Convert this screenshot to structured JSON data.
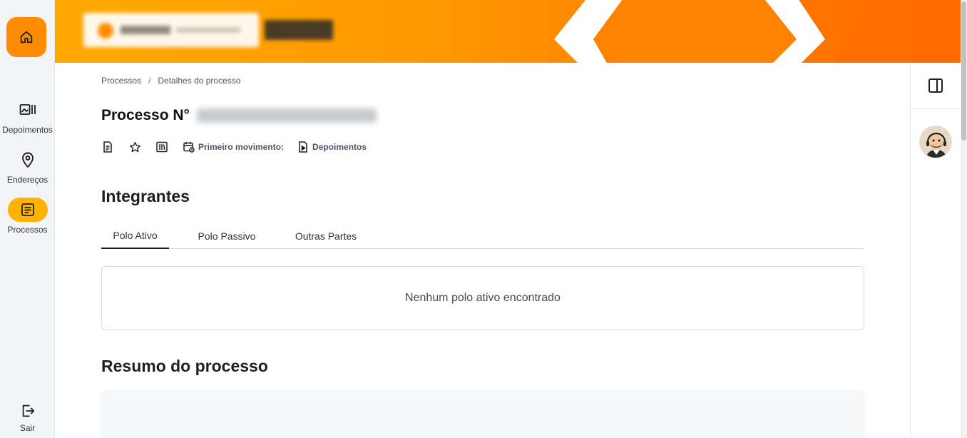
{
  "nav": {
    "items": [
      {
        "label": "Depoimentos",
        "icon": "gallery-icon"
      },
      {
        "label": "Endereços",
        "icon": "location-pin-icon"
      },
      {
        "label": "Processos",
        "icon": "document-list-icon"
      }
    ],
    "logout_label": "Sair"
  },
  "breadcrumb": {
    "items": [
      "Processos",
      "Detalhes do processo"
    ],
    "separator": "/"
  },
  "process": {
    "title": "Processo N°"
  },
  "actions": {
    "first_movement_label": "Primeiro movimento:",
    "depoimentos_label": "Depoimentos"
  },
  "members": {
    "title": "Integrantes",
    "tabs": [
      "Polo Ativo",
      "Polo Passivo",
      "Outras Partes"
    ],
    "empty_message": "Nenhum polo ativo encontrado"
  },
  "summary": {
    "title": "Resumo do processo"
  },
  "colors": {
    "accent": "#ff8c00",
    "active_nav": "#ffb300",
    "banner_start": "#ffa800",
    "banner_end": "#ff6a00"
  }
}
